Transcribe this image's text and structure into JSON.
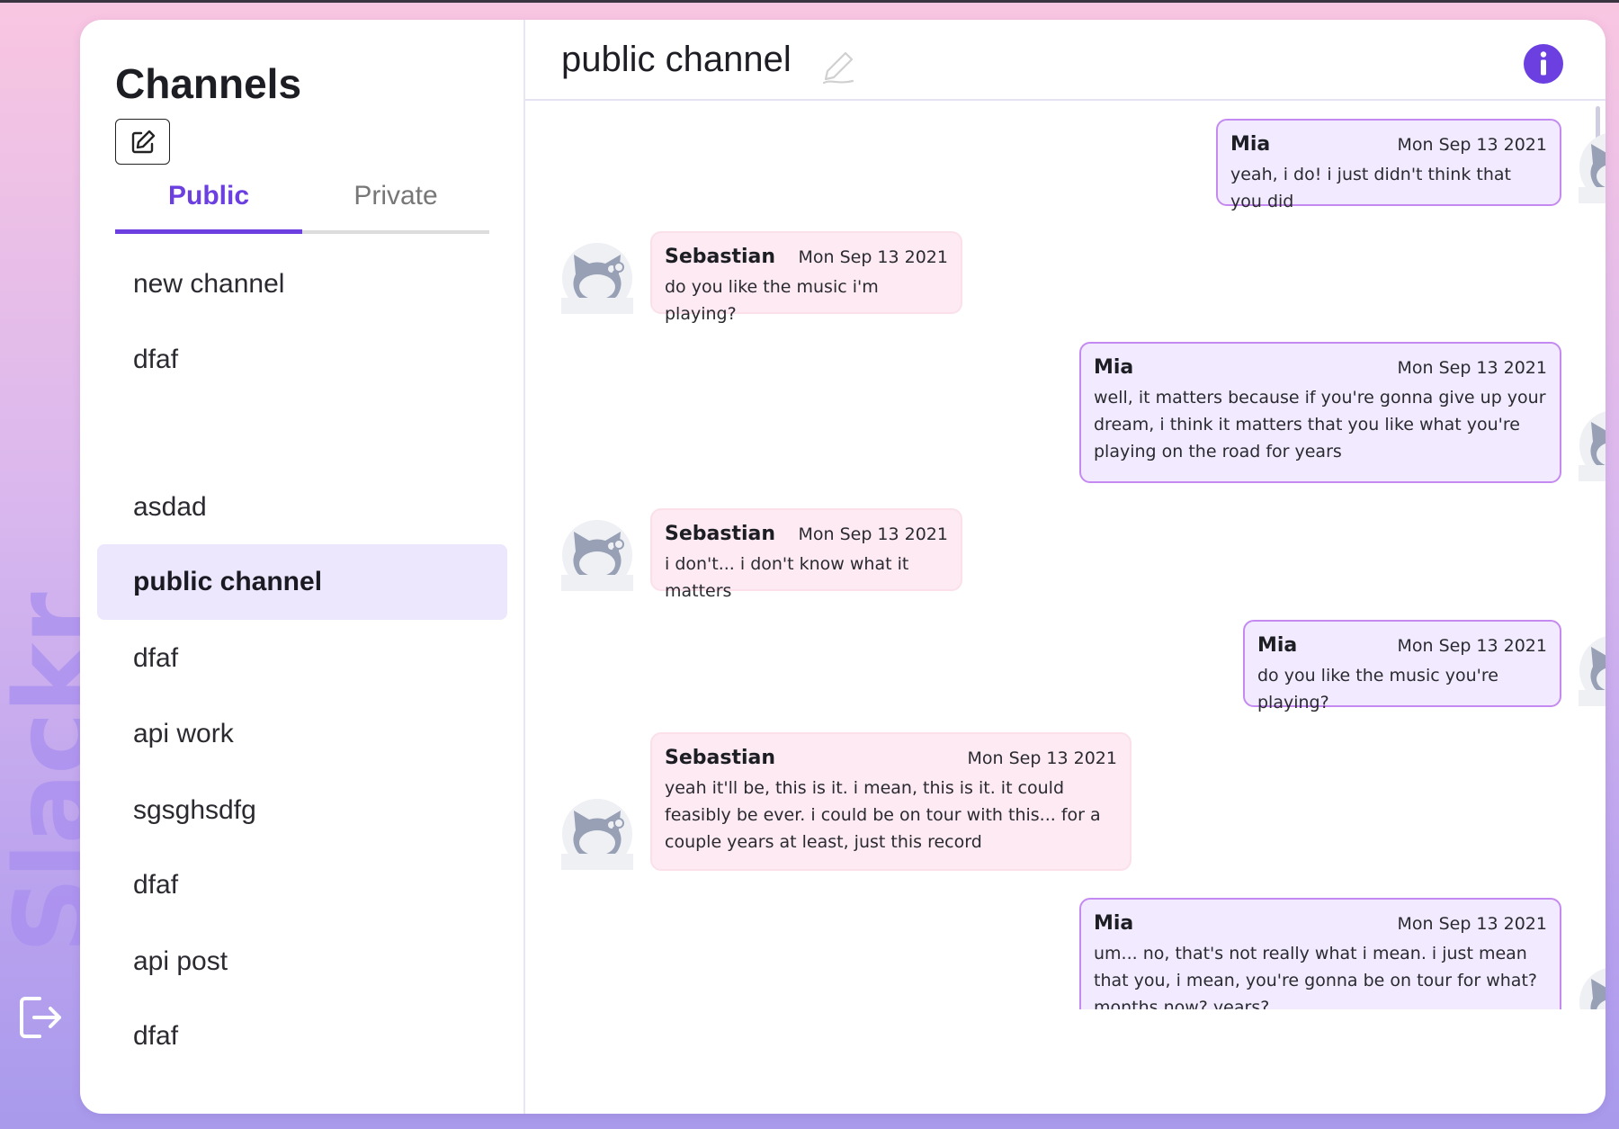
{
  "app": {
    "brand": "Slackr"
  },
  "sidebar": {
    "title": "Channels",
    "tabs": [
      {
        "label": "Public",
        "active": true
      },
      {
        "label": "Private",
        "active": false
      }
    ],
    "channels": [
      {
        "name": "new channel"
      },
      {
        "name": "dfaf"
      },
      {
        "name": ""
      },
      {
        "name": "asdad"
      },
      {
        "name": "public channel",
        "active": true
      },
      {
        "name": "dfaf"
      },
      {
        "name": "api work"
      },
      {
        "name": "sgsghsdfg"
      },
      {
        "name": "dfaf"
      },
      {
        "name": "api post"
      },
      {
        "name": "dfaf"
      }
    ]
  },
  "chat": {
    "title": "public channel",
    "messages": [
      {
        "author": "Mia",
        "date": "Mon Sep 13 2021",
        "text": "yeah, i do! i just didn't think that you did",
        "mine": true
      },
      {
        "author": "Sebastian",
        "date": "Mon Sep 13 2021",
        "text": "do you like the music i'm playing?",
        "mine": false
      },
      {
        "author": "Mia",
        "date": "Mon Sep 13 2021",
        "text": "well, it matters because if you're gonna give up your dream, i think it matters that you like what you're playing on the road for years",
        "mine": true
      },
      {
        "author": "Sebastian",
        "date": "Mon Sep 13 2021",
        "text": "i don't... i don't know what it matters",
        "mine": false
      },
      {
        "author": "Mia",
        "date": "Mon Sep 13 2021",
        "text": "do you like the music you're playing?",
        "mine": true
      },
      {
        "author": "Sebastian",
        "date": "Mon Sep 13 2021",
        "text": "yeah it'll be, this is it. i mean, this is it. it could feasibly be ever. i could be on tour with this... for a couple years at least, just this record",
        "mine": false
      },
      {
        "author": "Mia",
        "date": "Mon Sep 13 2021",
        "text": "um... no, that's not really what i mean. i just mean that you, i mean, you're gonna be on tour for what? months now? years?",
        "mine": true
      }
    ]
  },
  "colors": {
    "accent": "#6c3fe0",
    "mine_bubble_bg": "#f2ebff",
    "mine_bubble_border": "#c58af1",
    "theirs_bubble_bg": "#fdeaf2",
    "active_channel_bg": "#ece7fc"
  },
  "icons": {
    "logout": "logout-icon",
    "new_channel": "edit-square-icon",
    "edit_title": "pencil-icon",
    "info": "info-icon",
    "avatar": "kitty-avatar-icon"
  }
}
